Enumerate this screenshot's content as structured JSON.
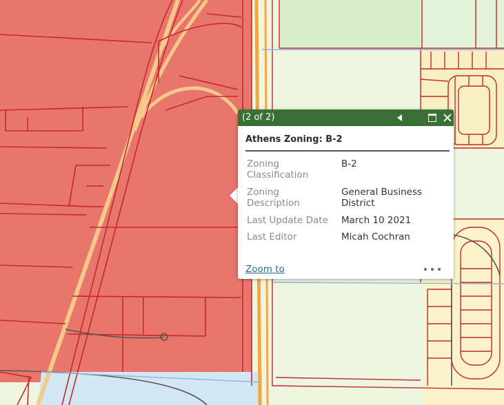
{
  "popup": {
    "count": "(2 of 2)",
    "title": "Athens Zoning: B-2",
    "header_color": "#3a6f35",
    "attributes": [
      {
        "label": "Zoning Classification",
        "value": "B-2"
      },
      {
        "label": "Zoning Description",
        "value": "General Business District"
      },
      {
        "label": "Last Update Date",
        "value": "March 10 2021"
      },
      {
        "label": "Last Editor",
        "value": "Micah Cochran"
      }
    ],
    "zoom_to": "Zoom to",
    "icons": {
      "previous": "caret-left-icon",
      "maximize": "maximize-icon",
      "close": "close-icon",
      "more": "ellipsis-icon"
    }
  },
  "map": {
    "colors": {
      "business_zone": "#e8766c",
      "residential_zone": "#eef5e1",
      "parcel_line": "#c4282a",
      "water": "#d3e6f3",
      "major_road": "#f4a640",
      "ramp": "#f5c98a"
    }
  }
}
